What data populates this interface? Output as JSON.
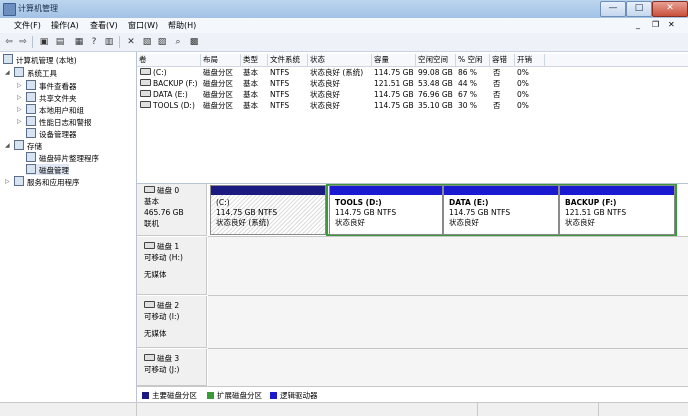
{
  "window": {
    "title": "计算机管理",
    "min": "—",
    "max": "□",
    "close": "✕"
  },
  "menu": [
    "文件(F)",
    "操作(A)",
    "查看(V)",
    "窗口(W)",
    "帮助(H)"
  ],
  "menu_right": {
    "min": "_",
    "restore": "❐",
    "close": "✕"
  },
  "tree": {
    "root": "计算机管理 (本地)",
    "system_tools": "系统工具",
    "event_viewer": "事件查看器",
    "shared_folders": "共享文件夹",
    "local_users": "本地用户和组",
    "perf_logs": "性能日志和警报",
    "device_manager": "设备管理器",
    "storage": "存储",
    "defrag": "磁盘碎片整理程序",
    "disk_mgmt": "磁盘管理",
    "services": "服务和应用程序"
  },
  "list": {
    "headers": [
      "卷",
      "布局",
      "类型",
      "文件系统",
      "状态",
      "容量",
      "空闲空间",
      "% 空闲",
      "容错",
      "开销"
    ],
    "rows": [
      [
        "(C:)",
        "磁盘分区",
        "基本",
        "NTFS",
        "状态良好 (系统)",
        "114.75 GB",
        "99.08 GB",
        "86 %",
        "否",
        "0%"
      ],
      [
        "BACKUP (F:)",
        "磁盘分区",
        "基本",
        "NTFS",
        "状态良好",
        "121.51 GB",
        "53.48 GB",
        "44 %",
        "否",
        "0%"
      ],
      [
        "DATA (E:)",
        "磁盘分区",
        "基本",
        "NTFS",
        "状态良好",
        "114.75 GB",
        "76.96 GB",
        "67 %",
        "否",
        "0%"
      ],
      [
        "TOOLS (D:)",
        "磁盘分区",
        "基本",
        "NTFS",
        "状态良好",
        "114.75 GB",
        "35.10 GB",
        "30 %",
        "否",
        "0%"
      ]
    ]
  },
  "disks": {
    "disk0": {
      "name": "磁盘 0",
      "type": "基本",
      "size": "465.76 GB",
      "status": "联机"
    },
    "disk1": {
      "name": "磁盘 1",
      "type": "可移动 (H:)",
      "media": "无媒体"
    },
    "disk2": {
      "name": "磁盘 2",
      "type": "可移动 (I:)",
      "media": "无媒体"
    },
    "disk3": {
      "name": "磁盘 3",
      "type": "可移动 (J:)"
    }
  },
  "partitions": [
    {
      "label": "(C:)",
      "size": "114.75 GB NTFS",
      "status": "状态良好 (系统)"
    },
    {
      "label": "TOOLS  (D:)",
      "size": "114.75 GB NTFS",
      "status": "状态良好"
    },
    {
      "label": "DATA  (E:)",
      "size": "114.75 GB NTFS",
      "status": "状态良好"
    },
    {
      "label": "BACKUP  (F:)",
      "size": "121.51 GB NTFS",
      "status": "状态良好"
    }
  ],
  "legend": [
    "主要磁盘分区",
    "扩展磁盘分区",
    "逻辑驱动器"
  ],
  "colors": {
    "primary": "#1a1a80",
    "extended": "#3a9a3a",
    "logical": "#1a1ad0"
  }
}
